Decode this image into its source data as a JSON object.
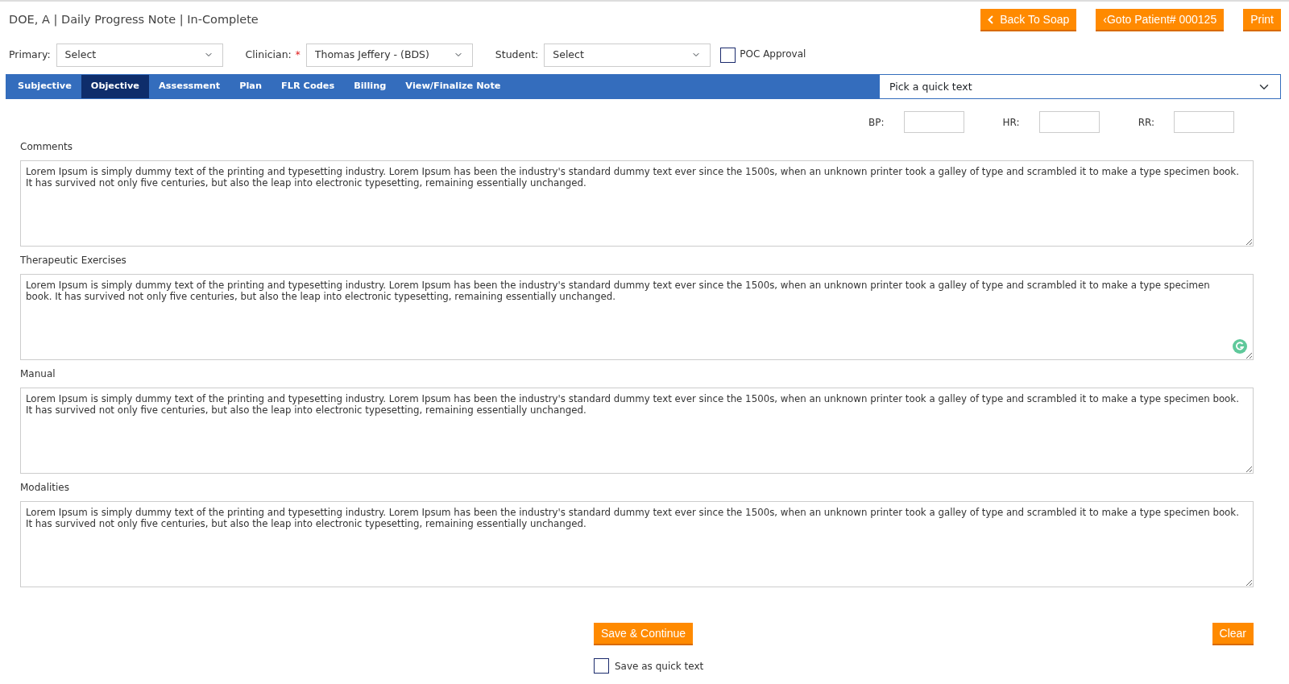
{
  "header": {
    "title": "DOE, A | Daily Progress Note | In-Complete"
  },
  "header_buttons": [
    {
      "kind": "back",
      "label": "Back To Soap"
    },
    {
      "kind": "plain",
      "label": "‹Goto Patient# 000125"
    },
    {
      "kind": "plain",
      "label": "Print"
    }
  ],
  "filters": [
    {
      "label": "Primary:",
      "value": "Select"
    },
    {
      "label": "Clinician:",
      "required_mark": "*",
      "value": "Thomas Jeffery - (BDS)"
    },
    {
      "label": "Student:",
      "value": "Select"
    }
  ],
  "poc_approval": {
    "label": "POC Approval",
    "checked": false
  },
  "tabs": [
    {
      "label": "Subjective",
      "selected": false
    },
    {
      "label": "Objective",
      "selected": true
    },
    {
      "label": "Assessment",
      "selected": false
    },
    {
      "label": "Plan",
      "selected": false
    },
    {
      "label": "FLR Codes",
      "selected": false
    },
    {
      "label": "Billing",
      "selected": false
    },
    {
      "label": "View/Finalize Note",
      "selected": false
    }
  ],
  "quick_text_select": {
    "value": "Pick a quick text"
  },
  "vitals": [
    {
      "label": "BP:"
    },
    {
      "label": "HR:"
    },
    {
      "label": "RR:"
    }
  ],
  "sections": [
    {
      "label": "Comments",
      "text": "Lorem Ipsum is simply dummy text of the printing and typesetting industry. Lorem Ipsum has been the industry's standard dummy text ever since the 1500s, when an unknown printer took a galley of type and scrambled it to make a type specimen book. It has survived not only five centuries, but also the leap into electronic typesetting, remaining essentially unchanged.",
      "grammar_badge": false
    },
    {
      "label": "Therapeutic Exercises",
      "text": "Lorem Ipsum is simply dummy text of the printing and typesetting industry. Lorem Ipsum has been the industry's standard dummy text ever since the 1500s, when an unknown printer took a galley of type and scrambled it to make a type specimen book. It has survived not only five centuries, but also the leap into electronic typesetting, remaining essentially unchanged.",
      "grammar_badge": true
    },
    {
      "label": "Manual",
      "text": "Lorem Ipsum is simply dummy text of the printing and typesetting industry. Lorem Ipsum has been the industry's standard dummy text ever since the 1500s, when an unknown printer took a galley of type and scrambled it to make a type specimen book. It has survived not only five centuries, but also the leap into electronic typesetting, remaining essentially unchanged.",
      "grammar_badge": false
    },
    {
      "label": "Modalities",
      "text": "Lorem Ipsum is simply dummy text of the printing and typesetting industry. Lorem Ipsum has been the industry's standard dummy text ever since the 1500s, when an unknown printer took a galley of type and scrambled it to make a type specimen book. It has survived not only five centuries, but also the leap into electronic typesetting, remaining essentially unchanged.",
      "grammar_badge": false
    }
  ],
  "footer": {
    "save_button": "Save & Continue",
    "clear_button": "Clear",
    "save_quick_text": {
      "label": "Save as quick text",
      "checked": false
    }
  }
}
